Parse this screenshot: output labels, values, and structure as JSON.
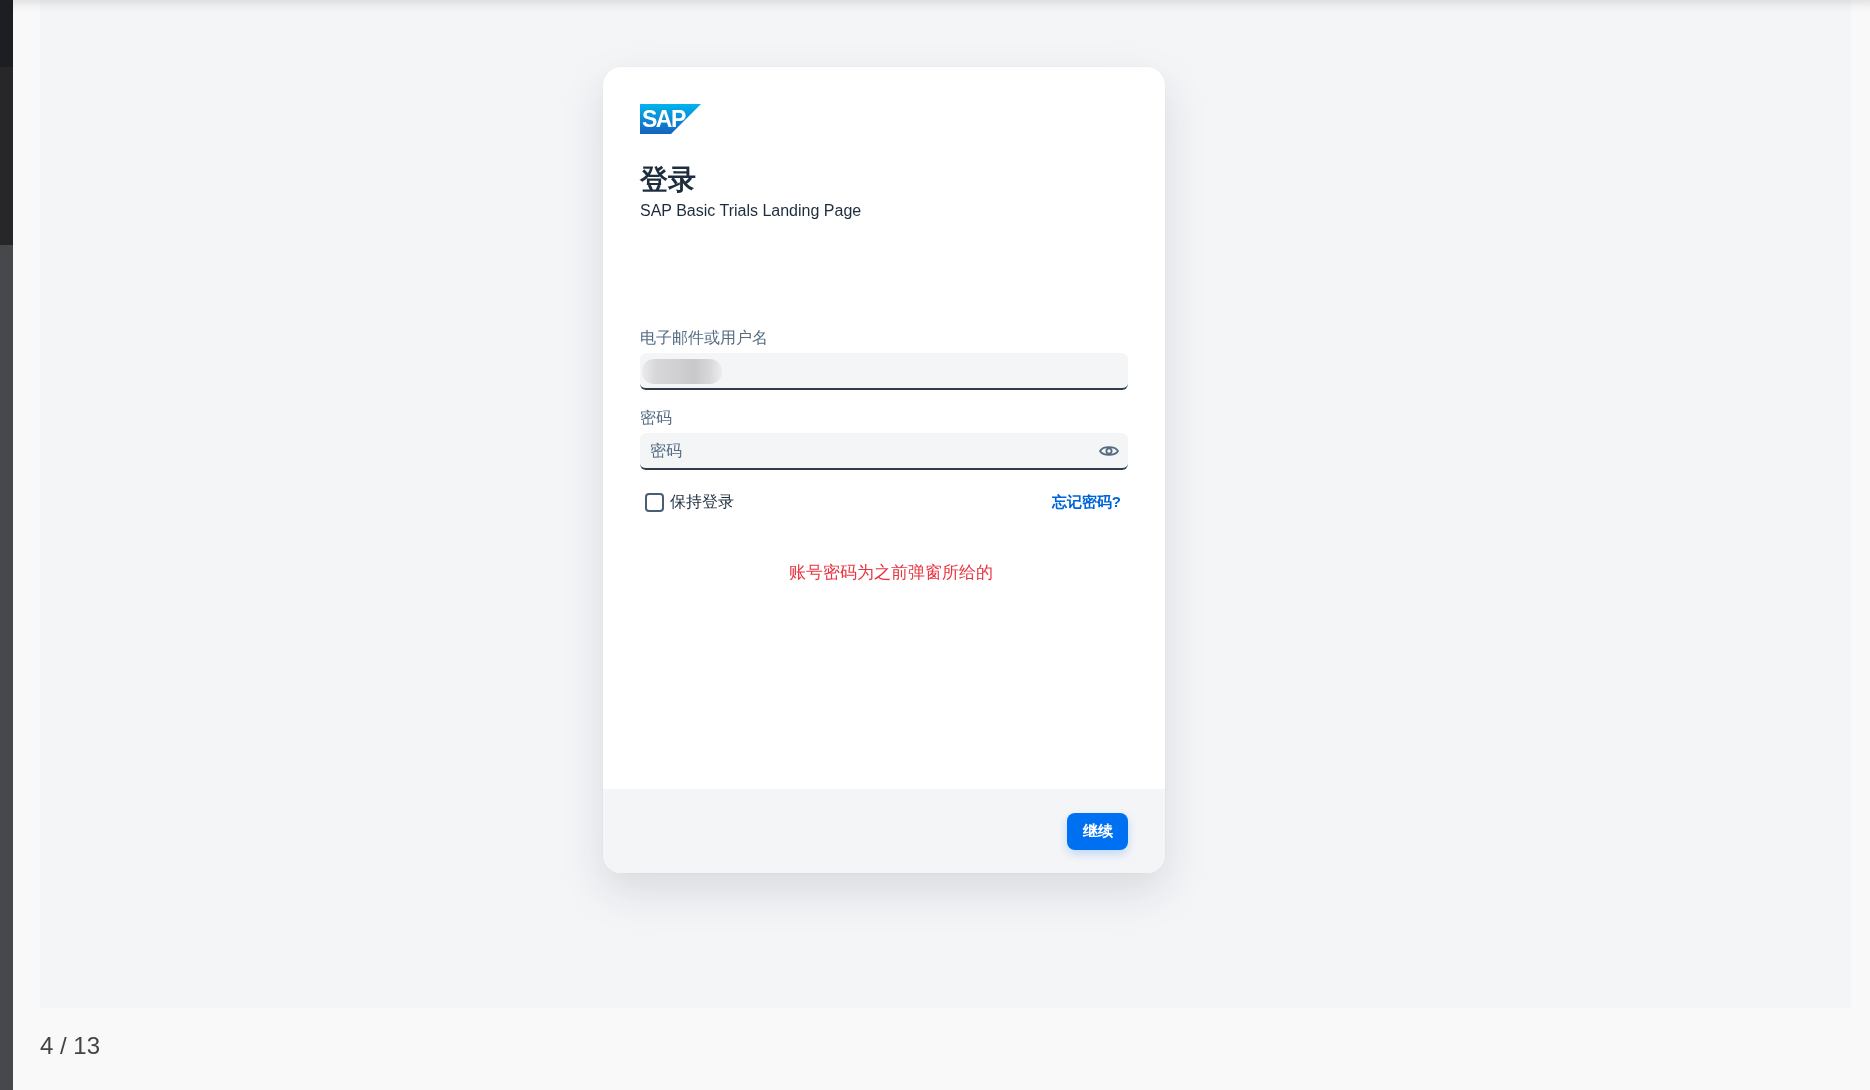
{
  "login_card": {
    "logo": "SAP",
    "title": "登录",
    "subtitle": "SAP Basic Trials Landing Page",
    "fields": [
      {
        "kind": "text",
        "label": "电子邮件或用户名",
        "redacted": true
      },
      {
        "kind": "password",
        "label": "密码",
        "placeholder": "密码",
        "redacted": false
      }
    ],
    "remember_me": {
      "label": "保持登录",
      "checked": false
    },
    "forgot_password": "忘记密码?",
    "notice": "账号密码为之前弹窗所给的",
    "footer": {
      "button": "继续"
    }
  },
  "viewer": {
    "page_indicator": "4 / 13"
  }
}
